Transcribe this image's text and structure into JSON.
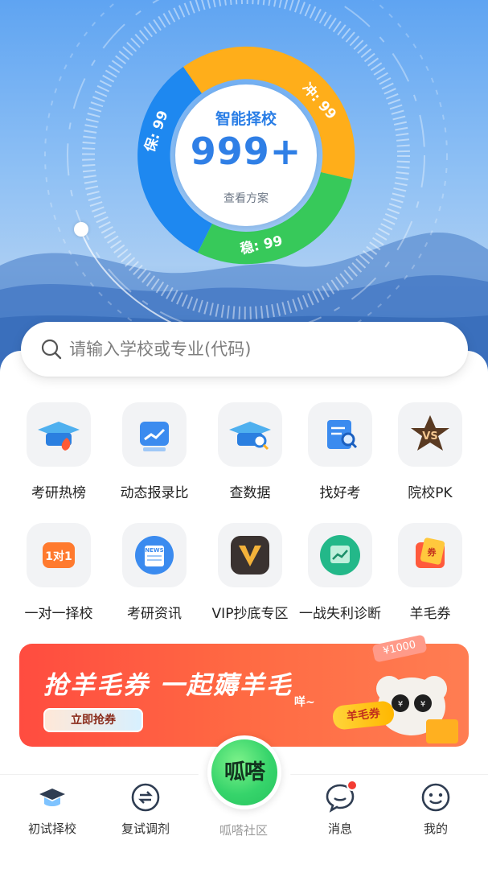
{
  "dial": {
    "title": "智能择校",
    "count": "999+",
    "link": "查看方案",
    "segments": {
      "safe": "保: 99",
      "reach": "冲: 99",
      "steady": "稳: 99"
    },
    "colors": {
      "safe": "#1e88f0",
      "reach": "#ffae1a",
      "steady": "#37c95a"
    }
  },
  "search": {
    "placeholder": "请输入学校或专业(代码)"
  },
  "grid": [
    {
      "label": "考研热榜",
      "icon": "graduation-cap-fire-icon"
    },
    {
      "label": "动态报录比",
      "icon": "trend-chart-icon"
    },
    {
      "label": "查数据",
      "icon": "data-search-cap-icon"
    },
    {
      "label": "找好考",
      "icon": "document-search-icon"
    },
    {
      "label": "院校PK",
      "icon": "vs-star-icon"
    },
    {
      "label": "一对一择校",
      "icon": "one-on-one-icon"
    },
    {
      "label": "考研资讯",
      "icon": "news-icon"
    },
    {
      "label": "VIP抄底专区",
      "icon": "vip-icon"
    },
    {
      "label": "一战失利诊断",
      "icon": "diagnosis-chart-icon"
    },
    {
      "label": "羊毛券",
      "icon": "coupon-icon"
    }
  ],
  "banner": {
    "title": "抢羊毛券 一起薅羊毛",
    "button": "立即抢券",
    "tag": "咩~",
    "coupon": "羊毛券",
    "price": "¥1000"
  },
  "tabs": [
    {
      "label": "初试择校",
      "icon": "graduation-cap-icon"
    },
    {
      "label": "复试调剂",
      "icon": "swap-icon"
    },
    {
      "label": "呱嗒社区",
      "icon": "community-icon"
    },
    {
      "label": "消息",
      "icon": "message-icon"
    },
    {
      "label": "我的",
      "icon": "profile-face-icon"
    }
  ],
  "fab": {
    "label": "呱嗒"
  }
}
